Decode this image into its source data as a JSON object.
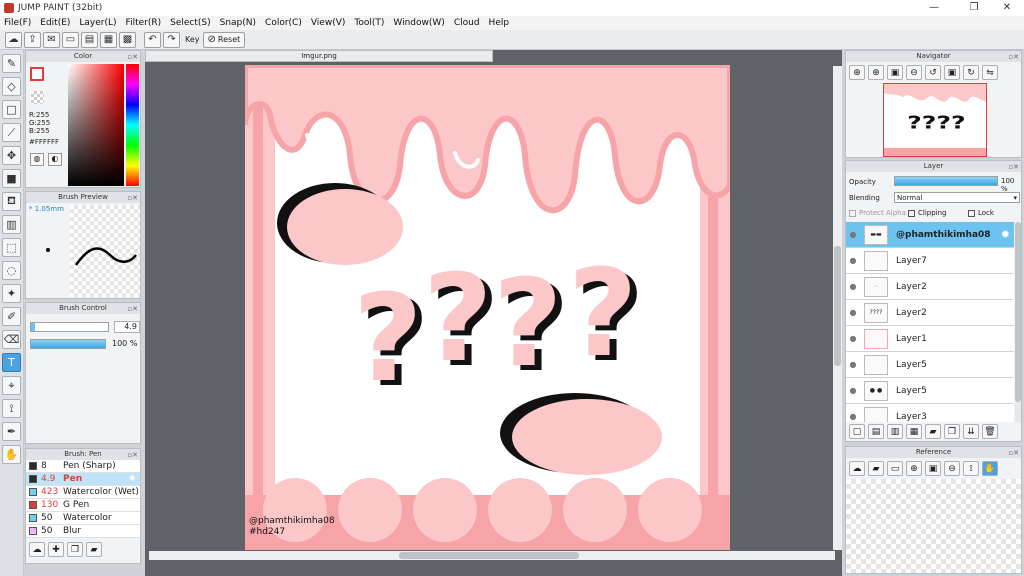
{
  "window": {
    "title": "JUMP PAINT (32bit)",
    "minimize": "—",
    "maximize": "❐",
    "close": "✕"
  },
  "menu": [
    "File(F)",
    "Edit(E)",
    "Layer(L)",
    "Filter(R)",
    "Select(S)",
    "Snap(N)",
    "Color(C)",
    "View(V)",
    "Tool(T)",
    "Window(W)",
    "Cloud",
    "Help"
  ],
  "toolbar": {
    "key_label": "Key",
    "reset_label": "Reset"
  },
  "color_panel": {
    "title": "Color",
    "r": "R:255",
    "g": "G:255",
    "b": "B:255",
    "hex": "#FFFFFF"
  },
  "brush_preview": {
    "title": "Brush Preview",
    "size": "* 1.05mm"
  },
  "brush_control": {
    "title": "Brush Control",
    "size_value": "4.9",
    "opacity_value": "100 %",
    "size_fraction": 0.05,
    "opacity_fraction": 1.0
  },
  "brush_list": {
    "title": "Brush: Pen",
    "items": [
      {
        "size": "8",
        "name": "Pen (Sharp)",
        "color": "#2b2b2b"
      },
      {
        "size": "4.9",
        "name": "Pen",
        "color": "#2b2b2b",
        "selected": true
      },
      {
        "size": "423",
        "name": "Watercolor (Wet)",
        "color": "#6fd1ef"
      },
      {
        "size": "130",
        "name": "G Pen",
        "color": "#e23b3b"
      },
      {
        "size": "50",
        "name": "Watercolor",
        "color": "#6fd1ef"
      },
      {
        "size": "50",
        "name": "Blur",
        "color": "#f0b6f2"
      }
    ]
  },
  "document": {
    "tab": "Imgur.png"
  },
  "canvas": {
    "signature_line1": "@phamthikimha08",
    "signature_line2": "#hd247",
    "colors": {
      "pink": "#f7a4a8",
      "light_pink": "#fbc7c9",
      "white": "#ffffff",
      "black": "#111111"
    }
  },
  "navigator": {
    "title": "Navigator"
  },
  "layer_panel": {
    "title": "Layer",
    "opacity_label": "Opacity",
    "opacity_value": "100 %",
    "blending_label": "Blending",
    "blending_value": "Normal",
    "protect_alpha": "Protect Alpha",
    "clipping": "Clipping",
    "lock": "Lock",
    "layers": [
      {
        "name": "@phamthikimha08",
        "selected": true
      },
      {
        "name": "Layer7"
      },
      {
        "name": "Layer2"
      },
      {
        "name": "Layer2"
      },
      {
        "name": "Layer1"
      },
      {
        "name": "Layer5"
      },
      {
        "name": "Layer5"
      },
      {
        "name": "Layer3"
      }
    ]
  },
  "reference": {
    "title": "Reference"
  }
}
